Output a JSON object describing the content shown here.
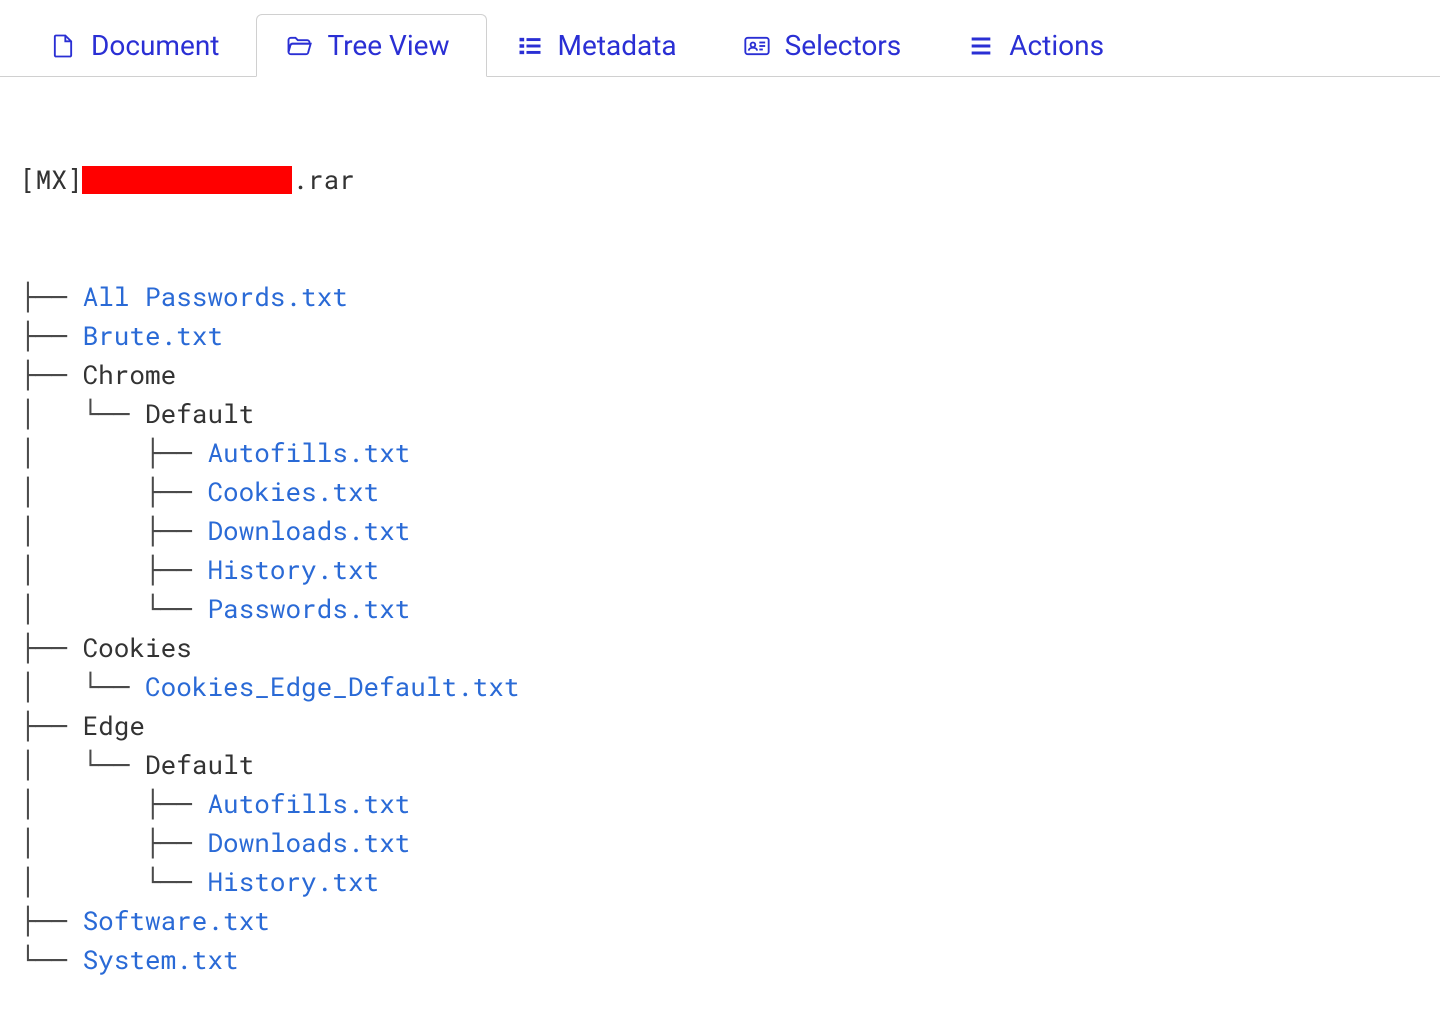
{
  "tabs": [
    {
      "label": "Document",
      "icon": "file-icon",
      "active": false
    },
    {
      "label": "Tree View",
      "icon": "folder-open-icon",
      "active": true
    },
    {
      "label": "Metadata",
      "icon": "list-icon",
      "active": false
    },
    {
      "label": "Selectors",
      "icon": "id-card-icon",
      "active": false
    },
    {
      "label": "Actions",
      "icon": "menu-icon",
      "active": false
    }
  ],
  "root": {
    "prefix": "[MX]",
    "suffix": ".rar"
  },
  "tree": [
    {
      "prefix": "├── ",
      "text": "All Passwords.txt",
      "link": true
    },
    {
      "prefix": "├── ",
      "text": "Brute.txt",
      "link": true
    },
    {
      "prefix": "├── ",
      "text": "Chrome",
      "link": false
    },
    {
      "prefix": "│   └── ",
      "text": "Default",
      "link": false
    },
    {
      "prefix": "│       ├── ",
      "text": "Autofills.txt",
      "link": true
    },
    {
      "prefix": "│       ├── ",
      "text": "Cookies.txt",
      "link": true
    },
    {
      "prefix": "│       ├── ",
      "text": "Downloads.txt",
      "link": true
    },
    {
      "prefix": "│       ├── ",
      "text": "History.txt",
      "link": true
    },
    {
      "prefix": "│       └── ",
      "text": "Passwords.txt",
      "link": true
    },
    {
      "prefix": "├── ",
      "text": "Cookies",
      "link": false
    },
    {
      "prefix": "│   └── ",
      "text": "Cookies_Edge_Default.txt",
      "link": true
    },
    {
      "prefix": "├── ",
      "text": "Edge",
      "link": false
    },
    {
      "prefix": "│   └── ",
      "text": "Default",
      "link": false
    },
    {
      "prefix": "│       ├── ",
      "text": "Autofills.txt",
      "link": true
    },
    {
      "prefix": "│       ├── ",
      "text": "Downloads.txt",
      "link": true
    },
    {
      "prefix": "│       └── ",
      "text": "History.txt",
      "link": true
    },
    {
      "prefix": "├── ",
      "text": "Software.txt",
      "link": true
    },
    {
      "prefix": "└── ",
      "text": "System.txt",
      "link": true
    }
  ]
}
